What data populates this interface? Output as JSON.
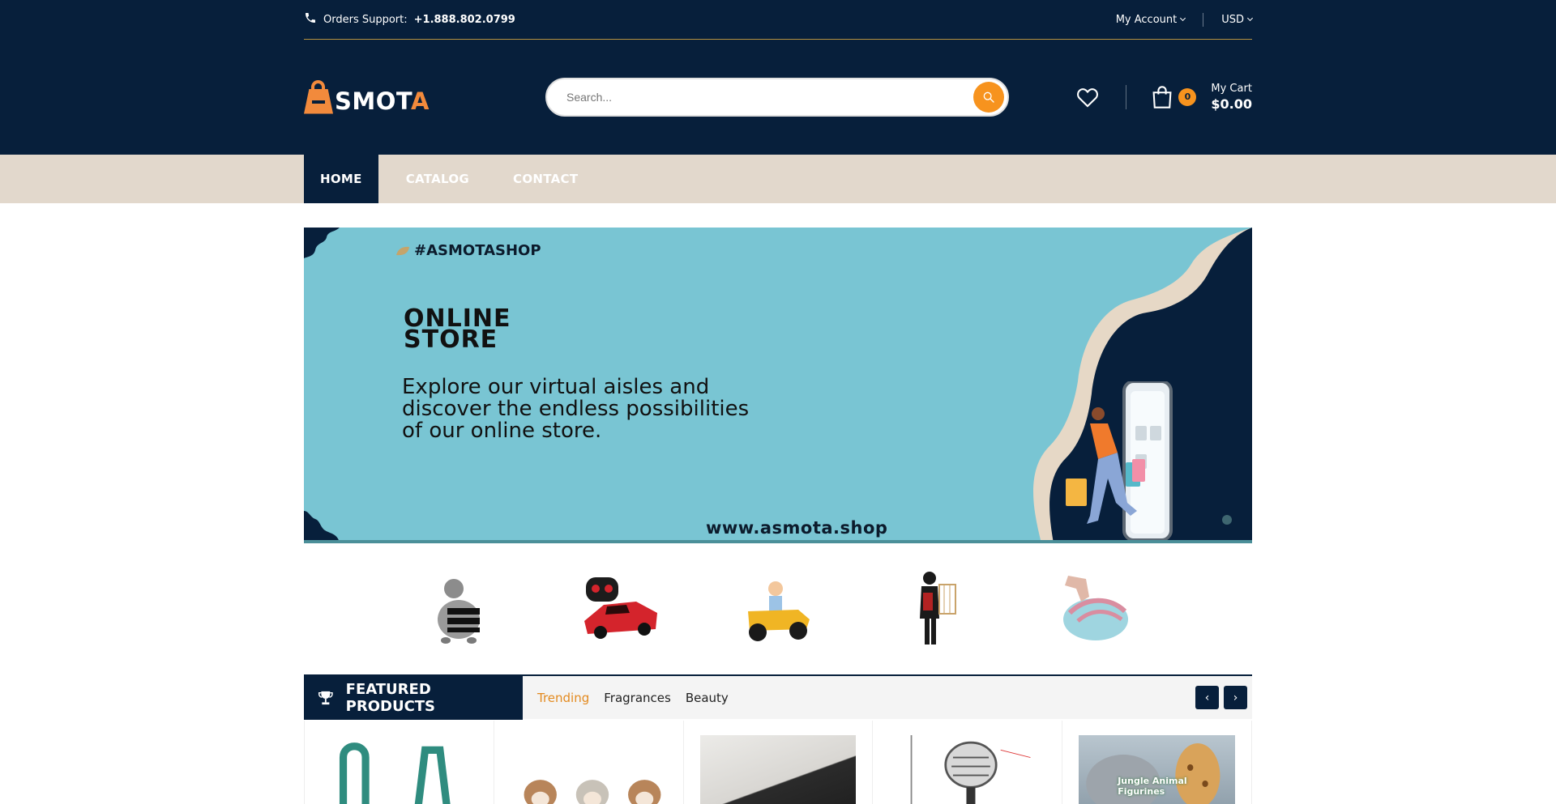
{
  "topbar": {
    "support_label": "Orders Support:",
    "support_phone": "+1.888.802.0799",
    "account_label": "My Account",
    "currency_label": "USD"
  },
  "logo": {
    "text_main": "SMOT",
    "text_last": "A"
  },
  "search": {
    "placeholder": "Search..."
  },
  "cart": {
    "count": "0",
    "label": "My Cart",
    "amount": "$0.00"
  },
  "nav": {
    "items": [
      {
        "label": "HOME",
        "active": true
      },
      {
        "label": "CATALOG",
        "active": false
      },
      {
        "label": "CONTACT",
        "active": false
      }
    ]
  },
  "hero": {
    "tag": "#ASMOTASHOP",
    "headline_line1": "ONLINE",
    "headline_line2": "STORE",
    "subtext": "Explore our virtual aisles and discover the endless possibilities of our online store.",
    "url": "www.asmota.shop"
  },
  "categories": [
    {
      "icon": "dog-costume-icon"
    },
    {
      "icon": "rc-car-icon"
    },
    {
      "icon": "ride-on-toy-icon"
    },
    {
      "icon": "halloween-figure-icon"
    },
    {
      "icon": "cake-decor-icon"
    }
  ],
  "featured": {
    "title": "FEATURED PRODUCTS",
    "tabs": [
      {
        "label": "Trending",
        "active": true
      },
      {
        "label": "Fragrances",
        "active": false
      },
      {
        "label": "Beauty",
        "active": false
      }
    ],
    "prev_label": "‹",
    "next_label": "›"
  },
  "products": [
    {
      "icon": "dog-harness-icon"
    },
    {
      "icon": "hamster-toy-icon"
    },
    {
      "icon": "desk-organizer-icon"
    },
    {
      "icon": "microphone-icon"
    },
    {
      "icon": "animal-figurines-icon",
      "overlay_text": "Jungle Animal Figurines"
    }
  ],
  "colors": {
    "navy": "#071f3b",
    "orange": "#f7931e",
    "beige": "#e2d8cc",
    "hero_blue": "#79c5d3"
  }
}
